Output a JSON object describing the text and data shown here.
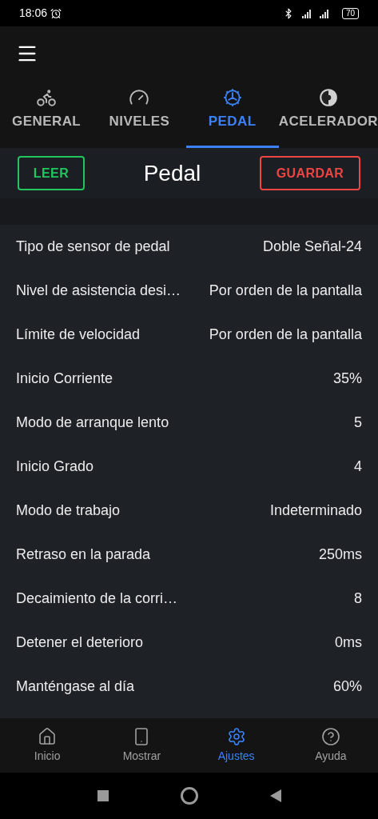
{
  "status_bar": {
    "time": "18:06",
    "battery": "70"
  },
  "tabs": [
    {
      "label": "GENERAL",
      "kind": "bike",
      "selected": false
    },
    {
      "label": "NIVELES",
      "kind": "gauge",
      "selected": false
    },
    {
      "label": "PEDAL",
      "kind": "sprocket",
      "selected": true
    },
    {
      "label": "ACELERADOR",
      "kind": "throttle",
      "selected": false
    }
  ],
  "header": {
    "read_button": "LEER",
    "title": "Pedal",
    "save_button": "GUARDAR"
  },
  "settings": [
    {
      "label": "Tipo de sensor de pedal",
      "value": "Doble Señal-24"
    },
    {
      "label": "Nivel de asistencia desi…",
      "value": "Por orden de la pantalla"
    },
    {
      "label": "Límite de velocidad",
      "value": "Por orden de la pantalla"
    },
    {
      "label": "Inicio Corriente",
      "value": "35%"
    },
    {
      "label": "Modo de arranque lento",
      "value": "5"
    },
    {
      "label": "Inicio Grado",
      "value": "4"
    },
    {
      "label": "Modo de trabajo",
      "value": "Indeterminado"
    },
    {
      "label": "Retraso en la parada",
      "value": "250ms"
    },
    {
      "label": "Decaimiento de la corri…",
      "value": "8"
    },
    {
      "label": "Detener el deterioro",
      "value": "0ms"
    },
    {
      "label": "Manténgase al día",
      "value": "60%"
    }
  ],
  "bottom_nav": [
    {
      "label": "Inicio",
      "kind": "home",
      "selected": false
    },
    {
      "label": "Mostrar",
      "kind": "display",
      "selected": false
    },
    {
      "label": "Ajustes",
      "kind": "settings",
      "selected": true
    },
    {
      "label": "Ayuda",
      "kind": "help",
      "selected": false
    }
  ]
}
